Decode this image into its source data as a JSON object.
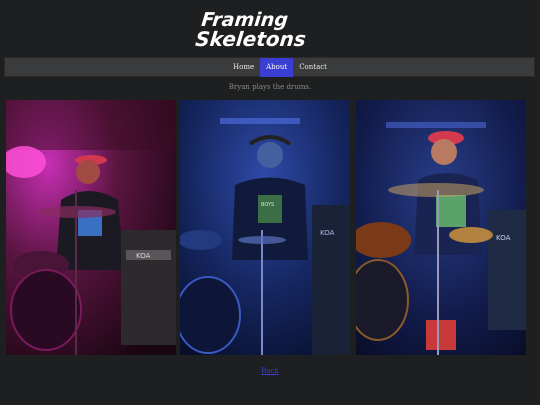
{
  "site": {
    "logo_text": "Framing Skeletons"
  },
  "nav": {
    "items": [
      {
        "label": "Home",
        "active": false
      },
      {
        "label": "About",
        "active": true
      },
      {
        "label": "Contact",
        "active": false
      }
    ]
  },
  "caption": "Bryan plays the drums.",
  "photos": [
    {
      "alt": "Drummer under red and magenta stage light"
    },
    {
      "alt": "Drummer under blue stage light"
    },
    {
      "alt": "Drummer playing under blue and amber light"
    }
  ],
  "amp_label": "KOA",
  "shirt_text": "BOYS",
  "back_link": "Back",
  "colors": {
    "accent": "#3b3ed2",
    "background": "#1e1f20",
    "nav": "#3a3b3c"
  }
}
